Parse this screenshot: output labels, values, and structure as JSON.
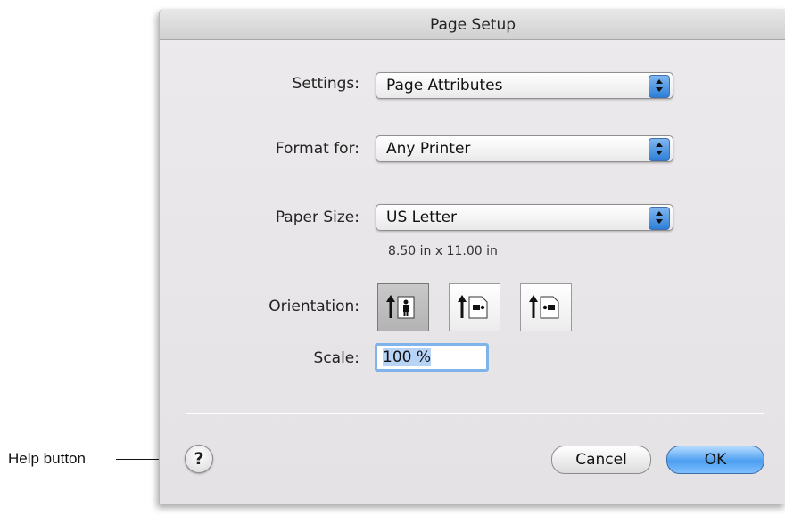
{
  "window": {
    "title": "Page Setup"
  },
  "settings": {
    "label": "Settings:",
    "value": "Page Attributes"
  },
  "format_for": {
    "label": "Format for:",
    "value": "Any Printer"
  },
  "paper_size": {
    "label": "Paper Size:",
    "value": "US Letter",
    "dimensions": "8.50 in x 11.00 in"
  },
  "orientation": {
    "label": "Orientation:",
    "options": [
      {
        "icon": "portrait-orientation-icon",
        "selected": true
      },
      {
        "icon": "landscape-left-orientation-icon",
        "selected": false
      },
      {
        "icon": "landscape-right-orientation-icon",
        "selected": false
      }
    ]
  },
  "scale": {
    "label": "Scale:",
    "value": "100 %"
  },
  "buttons": {
    "help": "?",
    "cancel": "Cancel",
    "ok": "OK"
  },
  "annotation": {
    "help_callout": "Help button"
  },
  "colors": {
    "accent": "#4c9ef0",
    "focus_ring": "#7fb3ea"
  }
}
